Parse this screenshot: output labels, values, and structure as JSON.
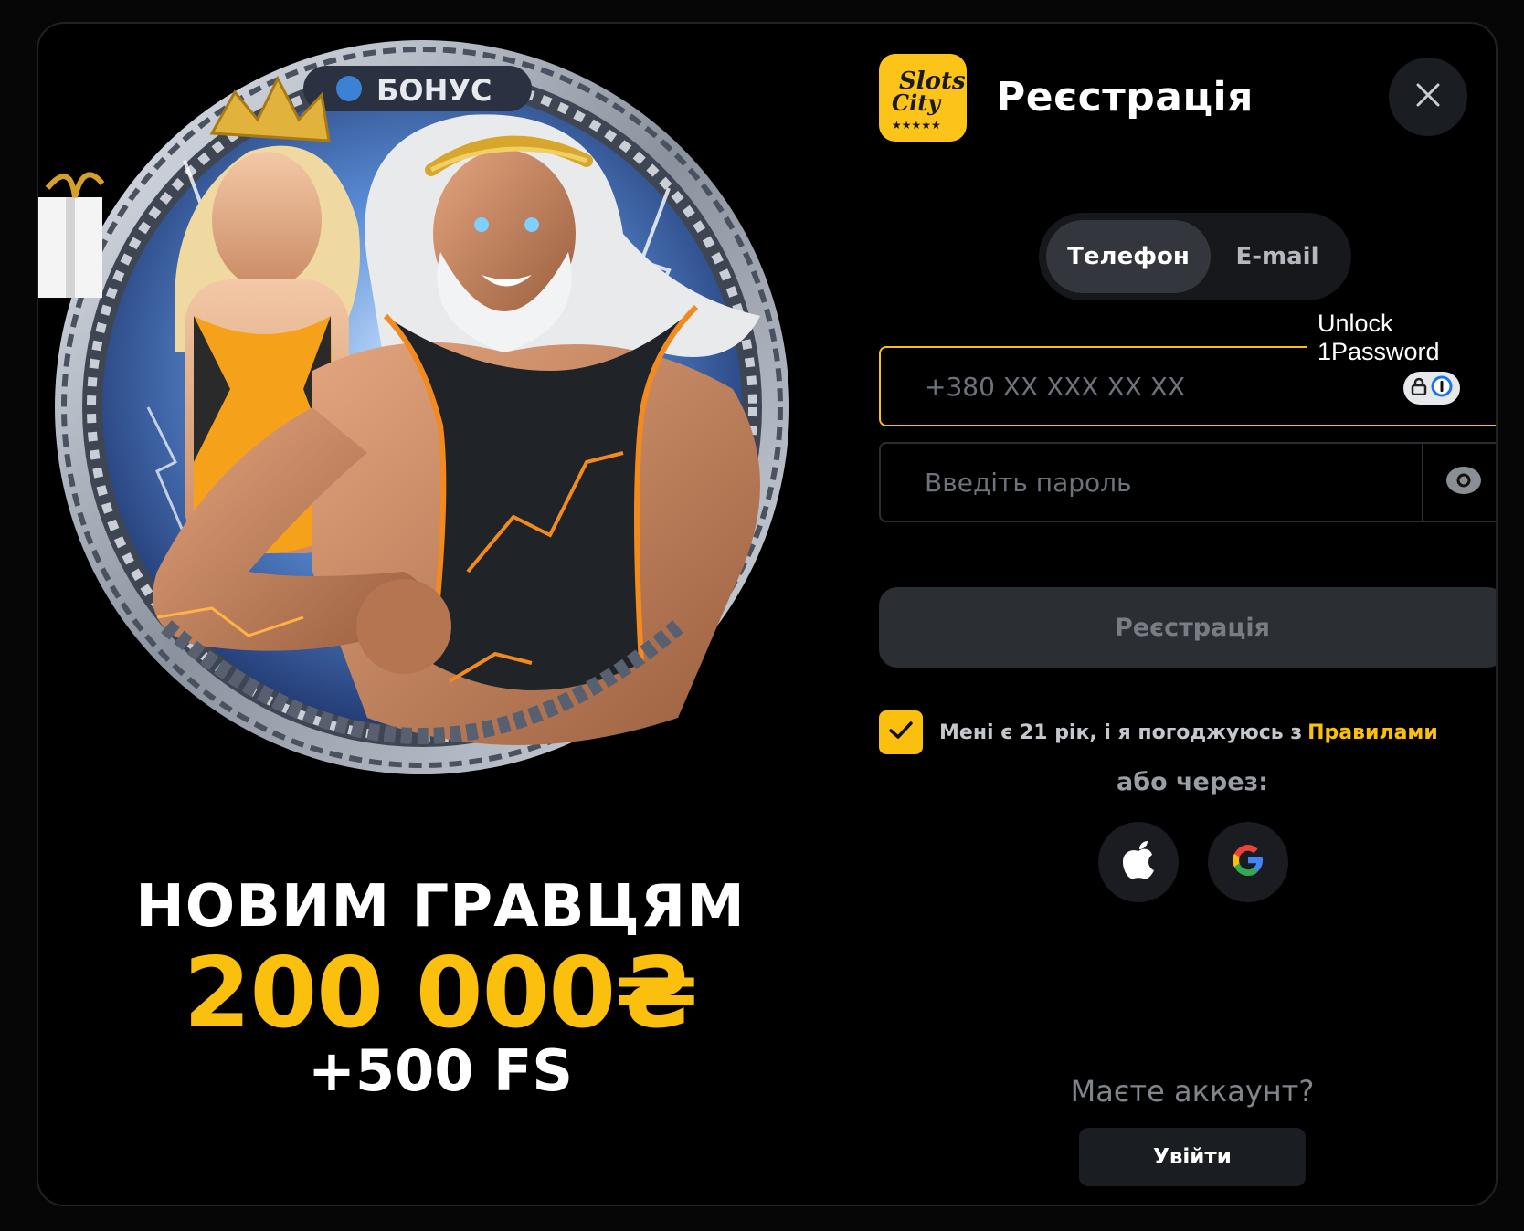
{
  "promo": {
    "badge_text": "БОНУС",
    "headline": "НОВИМ ГРАВЦЯМ",
    "amount": "200 000₴",
    "free_spins": "+500 FS"
  },
  "header": {
    "logo_text_line1": "Slots",
    "logo_text_line2": "City",
    "logo_stars": "★★★★★",
    "title": "Реєстрація",
    "close_icon": "close-icon"
  },
  "tabs": [
    {
      "label": "Телефон",
      "active": true
    },
    {
      "label": "E-mail",
      "active": false
    }
  ],
  "password_manager": {
    "tooltip": "Unlock 1Password"
  },
  "form": {
    "phone_placeholder": "+380 XX XXX XX XX",
    "password_placeholder": "Введіть пароль",
    "submit_label": "Реєстрація",
    "consent_text": "Мені є 21 рік, і я погоджуюсь з",
    "consent_link": "Правилами",
    "consent_checked": true,
    "or_via": "або через:"
  },
  "social": [
    {
      "name": "apple",
      "icon": "apple-icon"
    },
    {
      "name": "google",
      "icon": "google-icon"
    }
  ],
  "footer": {
    "have_account": "Маєте аккаунт?",
    "login_label": "Увійти"
  },
  "colors": {
    "accent": "#fbbf0e",
    "background": "#000000",
    "surface": "#1a1d22"
  }
}
